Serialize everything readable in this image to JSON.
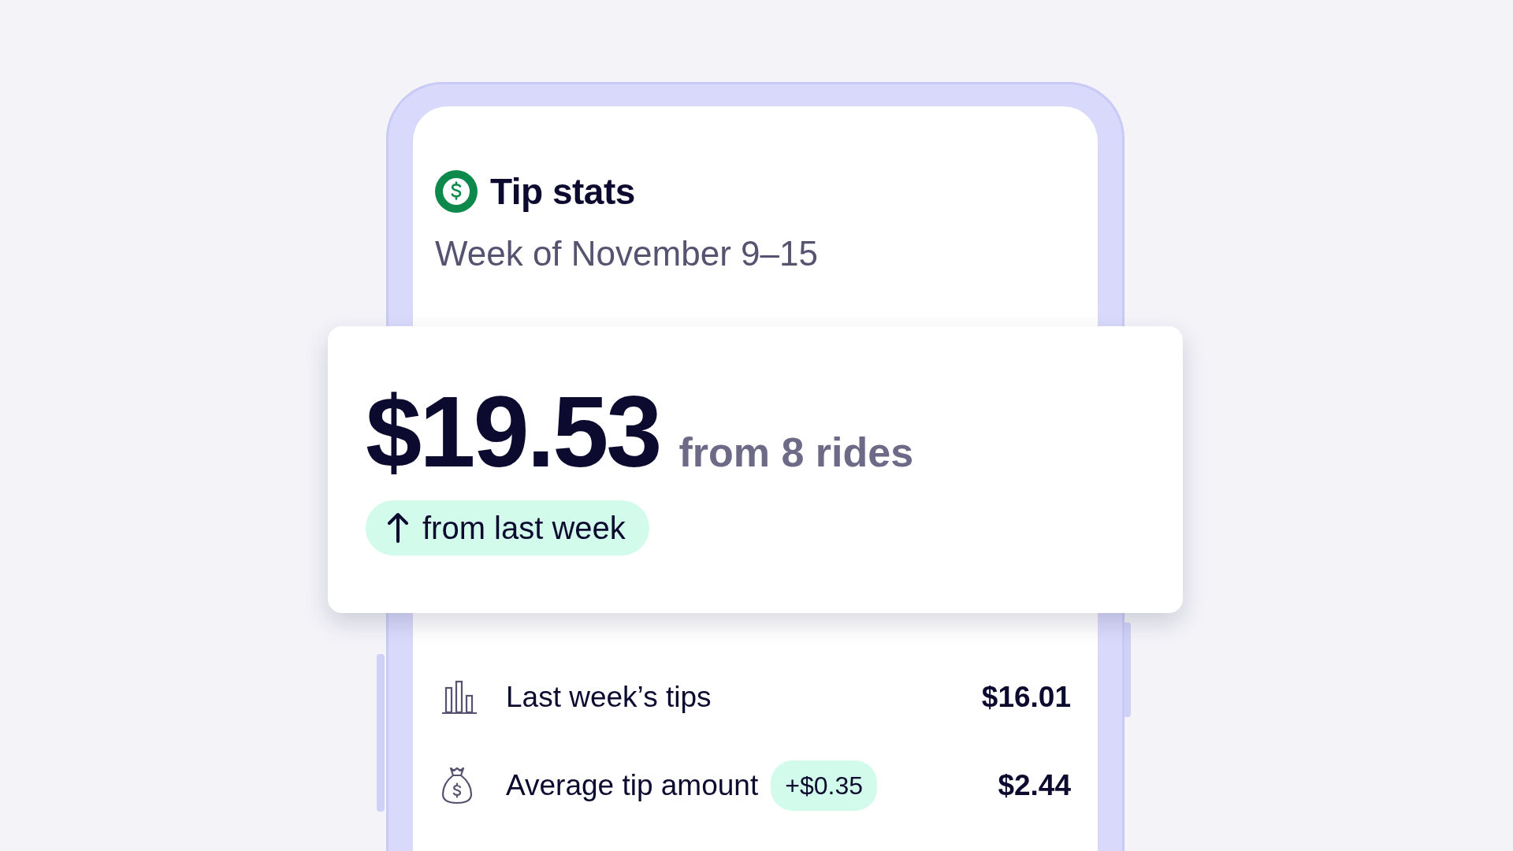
{
  "header": {
    "title": "Tip stats",
    "subtitle": "Week of November 9–15"
  },
  "summary": {
    "amount": "$19.53",
    "detail": "from 8 rides",
    "trend": {
      "rising": true,
      "label": "from last week"
    }
  },
  "stats": [
    {
      "kind": "bars",
      "label": "Last week’s tips",
      "value": "$16.01"
    },
    {
      "kind": "bag",
      "label": "Average tip amount",
      "badge": "+$0.35",
      "value": "$2.44"
    }
  ]
}
